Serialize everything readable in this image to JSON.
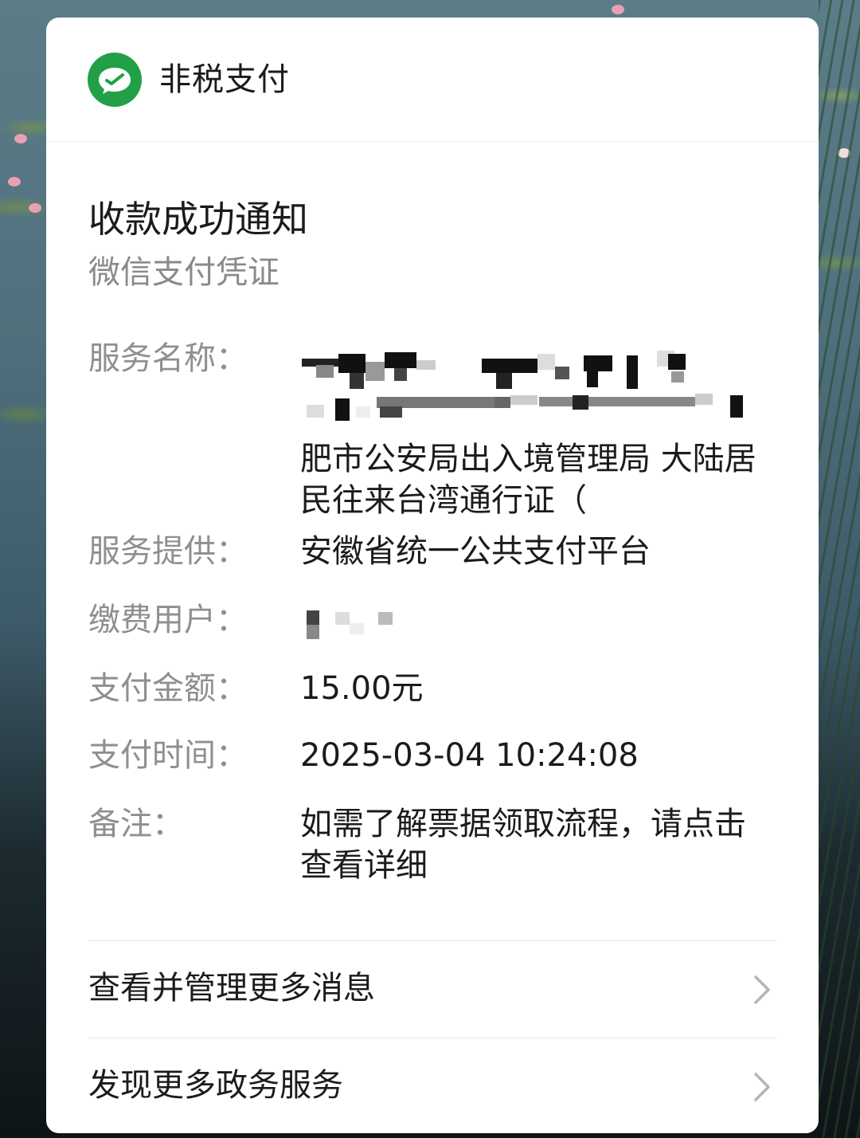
{
  "header": {
    "app_name": "非税支付",
    "logo_icon": "wechat-pay-icon"
  },
  "notice": {
    "title": "收款成功通知",
    "subtitle": "微信支付凭证"
  },
  "details": {
    "service_name": {
      "label": "服务名称：",
      "value_visible": "肥市公安局出入境管理局 大陆居民往来台湾通行证（"
    },
    "service_provider": {
      "label": "服务提供：",
      "value": "安徽省统一公共支付平台"
    },
    "payer": {
      "label": "缴费用户："
    },
    "amount": {
      "label": "支付金额：",
      "value": "15.00元"
    },
    "time": {
      "label": "支付时间：",
      "value": "2025-03-04 10:24:08"
    },
    "remark": {
      "label": "备注：",
      "value": "如需了解票据领取流程，请点击查看详细"
    }
  },
  "links": [
    {
      "label": "查看并管理更多消息",
      "icon": "chevron-right-icon"
    },
    {
      "label": "发现更多政务服务",
      "icon": "chevron-right-icon"
    }
  ],
  "colors": {
    "accent": "#21a047",
    "label": "#8f8f8f",
    "text": "#1b1b1b"
  }
}
